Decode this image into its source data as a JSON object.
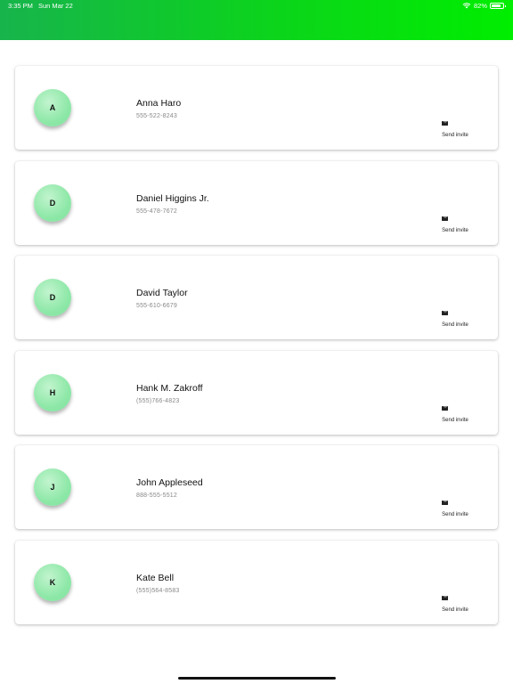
{
  "status_bar": {
    "time": "3:35 PM",
    "date": "Sun Mar 22",
    "battery": "82%",
    "battery_level": 0.82
  },
  "colors": {
    "header_start": "#17b44c",
    "header_end": "#00ee00",
    "avatar": "#8ee8a8"
  },
  "contacts": [
    {
      "initial": "A",
      "name": "Anna Haro",
      "phone": "555-522-8243",
      "action": "Send invite",
      "action_icon": "mail-icon"
    },
    {
      "initial": "D",
      "name": "Daniel Higgins Jr.",
      "phone": "555-478-7672",
      "action": "Send invite",
      "action_icon": "mail-icon"
    },
    {
      "initial": "D",
      "name": "David Taylor",
      "phone": "555-610-6679",
      "action": "Send invite",
      "action_icon": "mail-icon"
    },
    {
      "initial": "H",
      "name": "Hank M. Zakroff",
      "phone": "(555)766-4823",
      "action": "Send invite",
      "action_icon": "mail-icon"
    },
    {
      "initial": "J",
      "name": "John Appleseed",
      "phone": "888-555-5512",
      "action": "Send invite",
      "action_icon": "mail-icon"
    },
    {
      "initial": "K",
      "name": "Kate Bell",
      "phone": "(555)564-8583",
      "action": "Send invite",
      "action_icon": "mail-icon"
    }
  ]
}
